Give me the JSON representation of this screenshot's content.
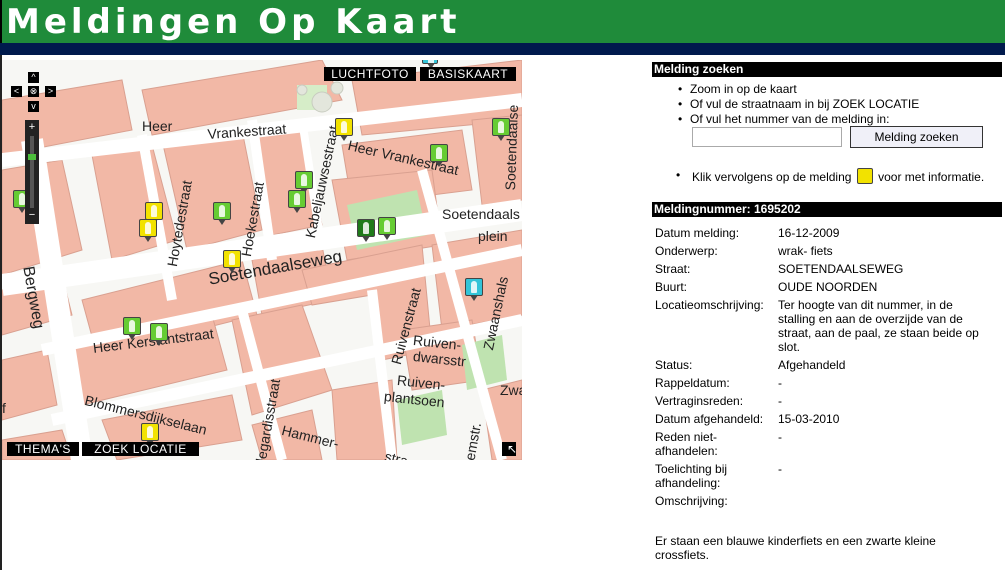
{
  "header": {
    "title": "Meldingen Op Kaart"
  },
  "map": {
    "buttons": {
      "luchtfoto": "LUCHTFOTO",
      "basiskaart": "BASISKAART",
      "themas": "THEMA'S",
      "zoek_locatie": "ZOEK LOCATIE"
    },
    "zoom": {
      "plus": "+",
      "minus": "−"
    },
    "pan": {
      "up": "^",
      "down": "v",
      "left": "<",
      "right": ">",
      "center": "⊗"
    },
    "streets": {
      "heer": "Heer",
      "vrankestraat": "Vrankestraat",
      "heer_vrankestraat": "Heer Vrankestraat",
      "hoytedestraat": "Hoytedestraat",
      "hoekestraat": "Hoekestraat",
      "kabeljauwsestraat": "Kabeljauwsestraat",
      "soetendaalsestraat": "Soetendaalse",
      "soetendaalseplein_a": "Soetendaals",
      "soetendaalseplein_b": "plein",
      "soetendaalseweg": "Soetendaalseweg",
      "bergweg": "Bergweg",
      "heer_kerstantstraat": "Heer Kerstantstraat",
      "ruivenstraat": "Ruivenstraat",
      "ruivendwarsstr_a": "Ruiven-",
      "ruivendwarsstr_b": "dwarsstr",
      "ruivenplantsoen_a": "Ruiven-",
      "ruivenplantsoen_b": "plantsoen",
      "zwaanshals": "Zwaanshals",
      "zwa": "Zwa",
      "blommersdijkselaan": "Blommersdijkselaan",
      "hammer": "Hammer-",
      "degardisstraat": "degardisstraat",
      "willemstr": "illemstr.",
      "stra": "stra",
      "f": "f"
    }
  },
  "search": {
    "title": "Melding zoeken",
    "bullet1": "Zoom in op de kaart",
    "bullet2": "Of vul de straatnaam in bij ZOEK LOCATIE",
    "bullet3": "Of vul het nummer van de melding in:",
    "input_value": "",
    "button": "Melding zoeken",
    "klik_before": "Klik vervolgens op de melding",
    "klik_after": "voor met informatie."
  },
  "details": {
    "title": "Meldingnummer: 1695202",
    "rows": [
      {
        "label": "Datum melding:",
        "value": "16-12-2009"
      },
      {
        "label": "Onderwerp:",
        "value": "wrak- fiets"
      },
      {
        "label": "Straat:",
        "value": "SOETENDAALSEWEG"
      },
      {
        "label": "Buurt:",
        "value": "OUDE NOORDEN"
      },
      {
        "label": "Locatieomschrijving:",
        "value": "Ter hoogte van dit nummer, in de stalling en aan de overzijde van de straat, aan de paal, ze staan beide op slot."
      },
      {
        "label": "Status:",
        "value": "Afgehandeld"
      },
      {
        "label": "Rappeldatum:",
        "value": "-"
      },
      {
        "label": "Vertraginsreden:",
        "value": "-"
      },
      {
        "label": "Datum afgehandeld:",
        "value": "15-03-2010"
      },
      {
        "label": "Reden niet-afhandelen:",
        "value": "-"
      },
      {
        "label": "Toelichting bij afhandeling:",
        "value": "-"
      }
    ],
    "omschrijving_label": "Omschrijving:",
    "omschrijving": "Er staan een blauwe kinderfiets en een zwarte kleine crossfiets."
  },
  "colors": {
    "header": "#1f8b3a",
    "navy": "#001a4d",
    "building": "#f2b8a6",
    "road": "#ffffff",
    "green_area": "#bfe3b0"
  }
}
